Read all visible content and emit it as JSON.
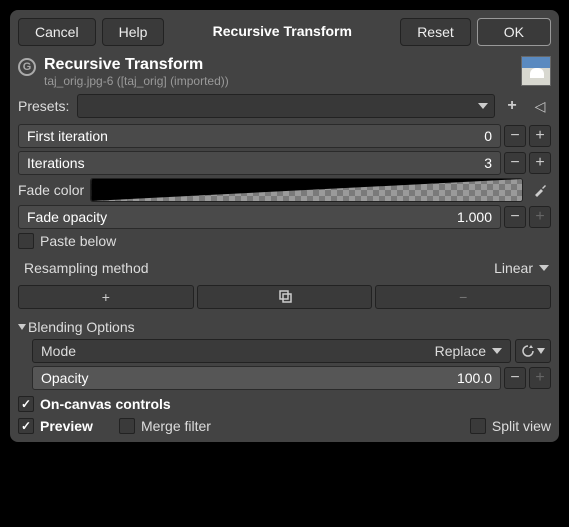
{
  "buttons": {
    "cancel": "Cancel",
    "help": "Help",
    "title": "Recursive Transform",
    "reset": "Reset",
    "ok": "OK"
  },
  "header": {
    "title": "Recursive Transform",
    "subtitle": "taj_orig.jpg-6 ([taj_orig] (imported))"
  },
  "presets_label": "Presets:",
  "first_iteration": {
    "label": "First iteration",
    "value": "0"
  },
  "iterations": {
    "label": "Iterations",
    "value": "3"
  },
  "fade_color_label": "Fade color",
  "fade_opacity": {
    "label": "Fade opacity",
    "value": "1.000"
  },
  "paste_below": "Paste below",
  "resampling": {
    "label": "Resampling method",
    "value": "Linear"
  },
  "blending": "Blending Options",
  "mode": {
    "label": "Mode",
    "value": "Replace"
  },
  "opacity": {
    "label": "Opacity",
    "value": "100.0"
  },
  "on_canvas": "On-canvas controls",
  "preview": "Preview",
  "merge_filter": "Merge filter",
  "split_view": "Split view"
}
